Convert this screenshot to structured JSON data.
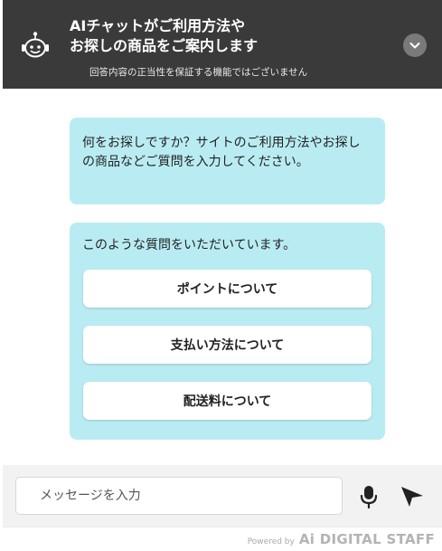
{
  "header": {
    "title_line1": "AIチャットがご利用方法や",
    "title_line2": "お探しの商品をご案内します",
    "disclaimer": "回答内容の正当性を保証する機能ではございません",
    "avatar_icon": "robot-icon",
    "collapse_icon": "chevron-down-icon"
  },
  "messages": {
    "intro": "何をお探しですか？サイトのご利用方法やお探しの商品などご質問を入力してください。",
    "suggest_lead": "このような質問をいただいています。",
    "suggestions": [
      {
        "label": "ポイントについて"
      },
      {
        "label": "支払い方法について"
      },
      {
        "label": "配送料について"
      }
    ]
  },
  "input": {
    "placeholder": "メッセージを入力",
    "value": "",
    "mic_icon": "microphone-icon",
    "send_icon": "send-icon"
  },
  "footer": {
    "powered_by": "Powered by",
    "brand": "Ai DIGITAL STAFF"
  },
  "colors": {
    "header_bg": "#3a3a3a",
    "bubble_bg": "#b9ecf2",
    "input_bar_bg": "#f2f2f2"
  }
}
